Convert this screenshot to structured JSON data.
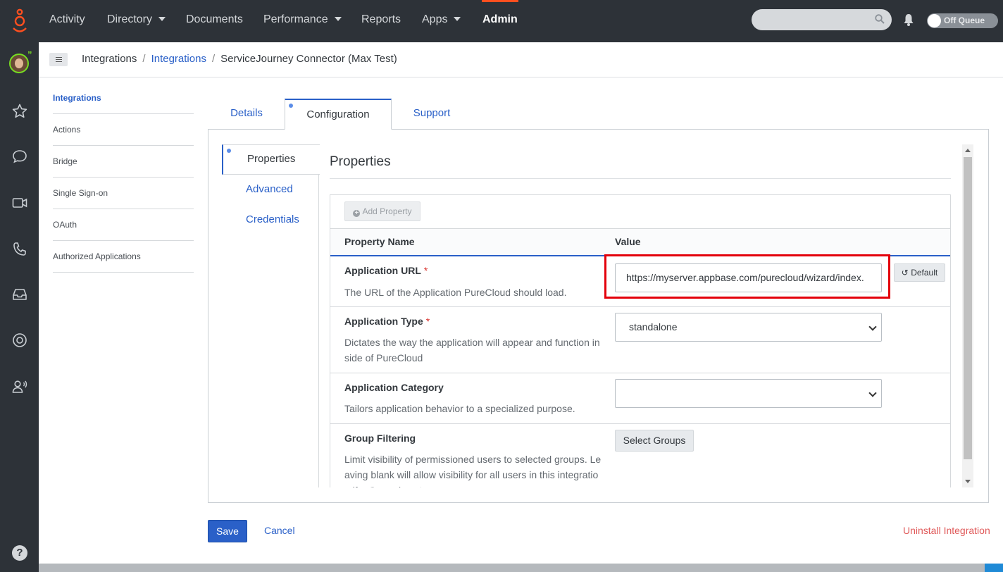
{
  "topnav": {
    "items": [
      {
        "label": "Activity",
        "dropdown": false
      },
      {
        "label": "Directory",
        "dropdown": true
      },
      {
        "label": "Documents",
        "dropdown": false
      },
      {
        "label": "Performance",
        "dropdown": true
      },
      {
        "label": "Reports",
        "dropdown": false
      },
      {
        "label": "Apps",
        "dropdown": true
      },
      {
        "label": "Admin",
        "dropdown": false,
        "active": true
      }
    ],
    "search_placeholder": "",
    "queue_toggle_label": "Off Queue",
    "accent_color": "#ff4f1f"
  },
  "rail": {
    "icons": [
      "star-icon",
      "chat-icon",
      "video-icon",
      "phone-icon",
      "inbox-icon",
      "lifebuoy-icon",
      "user-voice-icon"
    ],
    "help_label": "?"
  },
  "breadcrumb": {
    "items": [
      "Integrations",
      "Integrations",
      "ServiceJourney Connector (Max Test)"
    ]
  },
  "sidenav": {
    "items": [
      "Integrations",
      "Actions",
      "Bridge",
      "Single Sign-on",
      "OAuth",
      "Authorized Applications"
    ],
    "active_index": 0
  },
  "tabs": [
    "Details",
    "Configuration",
    "Support"
  ],
  "vtabs": [
    "Properties",
    "Advanced",
    "Credentials"
  ],
  "properties": {
    "title": "Properties",
    "add_property_label": "Add Property",
    "header_name": "Property Name",
    "header_value": "Value",
    "rows": [
      {
        "name": "Application URL",
        "required": "*",
        "description": "The URL of the Application PureCloud should load.",
        "value": "https://myserver.appbase.com/purecloud/wizard/index.",
        "default_label": "Default"
      },
      {
        "name": "Application Type",
        "required": "*",
        "description": "Dictates the way the application will appear and function inside of PureCloud",
        "value": "standalone"
      },
      {
        "name": "Application Category",
        "description": "Tailors application behavior to a specialized purpose.",
        "value": ""
      },
      {
        "name": "Group Filtering",
        "description": "Limit visibility of permissioned users to selected groups. Leaving blank will allow visibility for all users in this integration if a Group is not",
        "button_label": "Select Groups"
      }
    ]
  },
  "footer": {
    "save_label": "Save",
    "cancel_label": "Cancel",
    "uninstall_label": "Uninstall Integration"
  },
  "colors": {
    "link": "#2a60c8",
    "highlight": "#e3000b",
    "danger_link": "#e05a5a",
    "nav_bg": "#2d3238"
  }
}
